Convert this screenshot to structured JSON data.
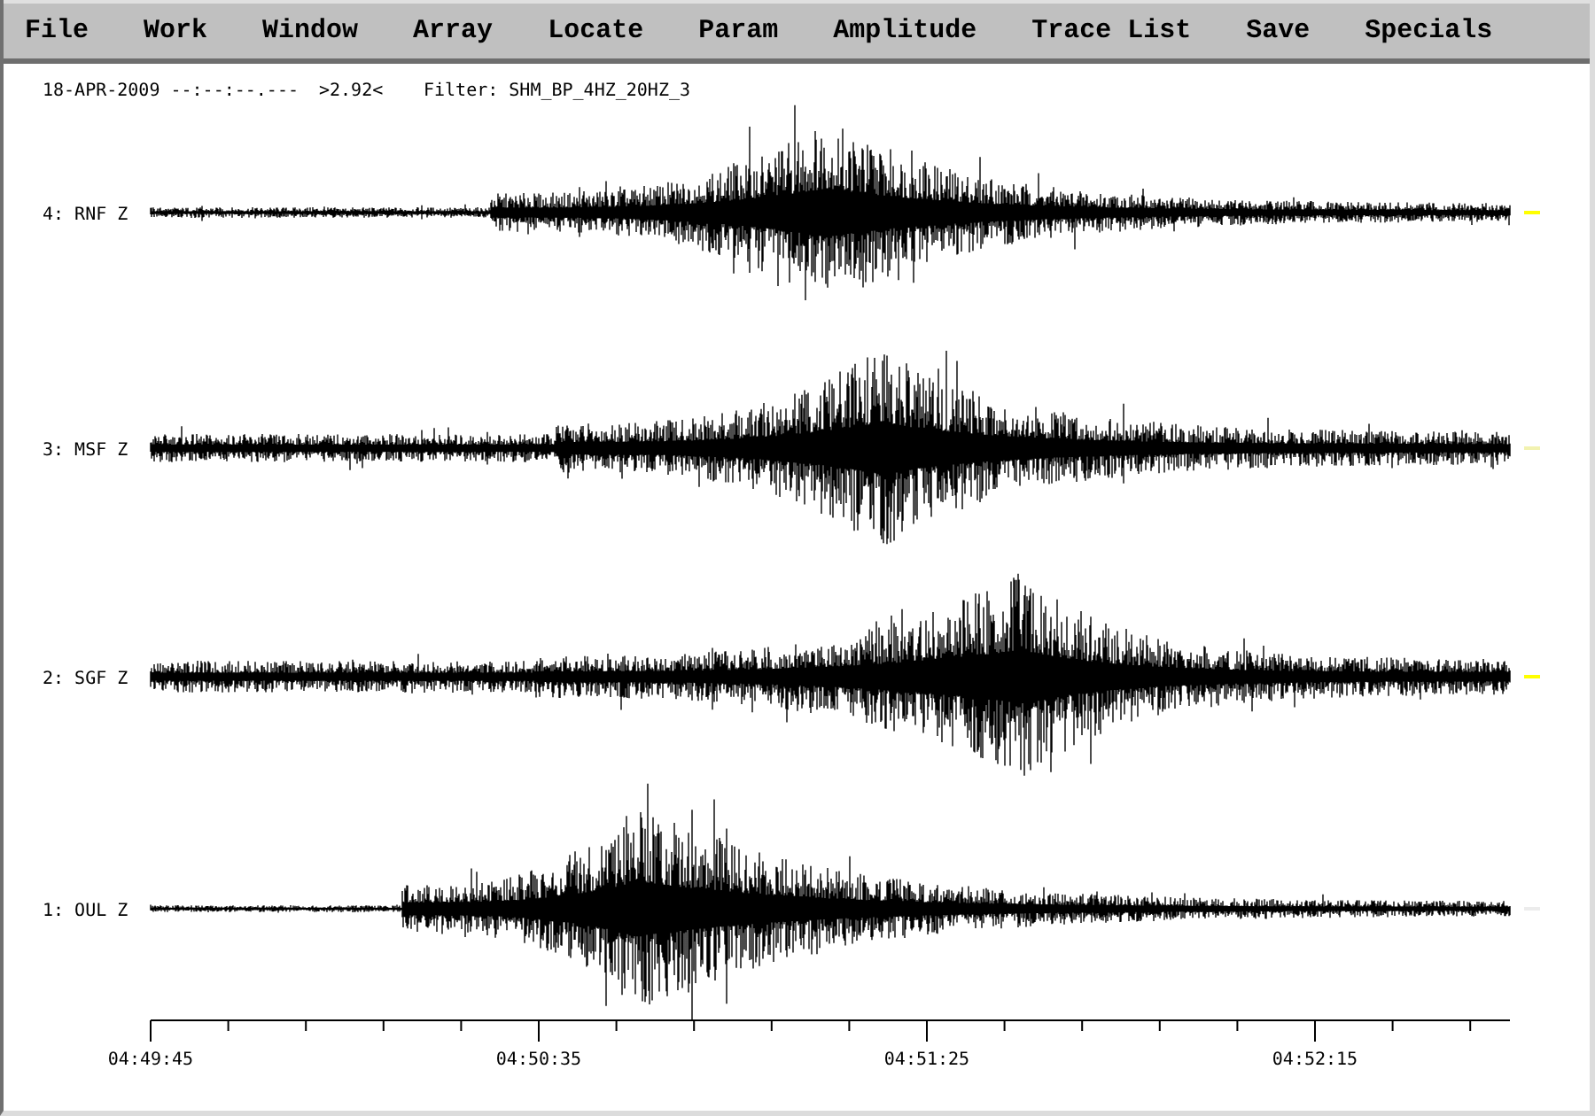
{
  "menu": [
    {
      "label": "File"
    },
    {
      "label": "Work"
    },
    {
      "label": "Window"
    },
    {
      "label": "Array"
    },
    {
      "label": "Locate"
    },
    {
      "label": "Param"
    },
    {
      "label": "Amplitude"
    },
    {
      "label": "Trace List"
    },
    {
      "label": "Save"
    },
    {
      "label": "Specials"
    }
  ],
  "header": {
    "date_time": "18-APR-2009 --:--:--.---",
    "value": ">2.92<",
    "filter": "Filter: SHM_BP_4HZ_20HZ_3"
  },
  "traces": [
    {
      "label": "4: RNF Z",
      "color": "#ffff00"
    },
    {
      "label": "3: MSF Z",
      "color": "#f2f2b0"
    },
    {
      "label": "2: SGF Z",
      "color": "#ffff00"
    },
    {
      "label": "1: OUL Z",
      "color": "#ececec"
    }
  ],
  "time_axis": {
    "labels": [
      "04:49:45",
      "04:50:35",
      "04:51:25",
      "04:52:15"
    ]
  }
}
